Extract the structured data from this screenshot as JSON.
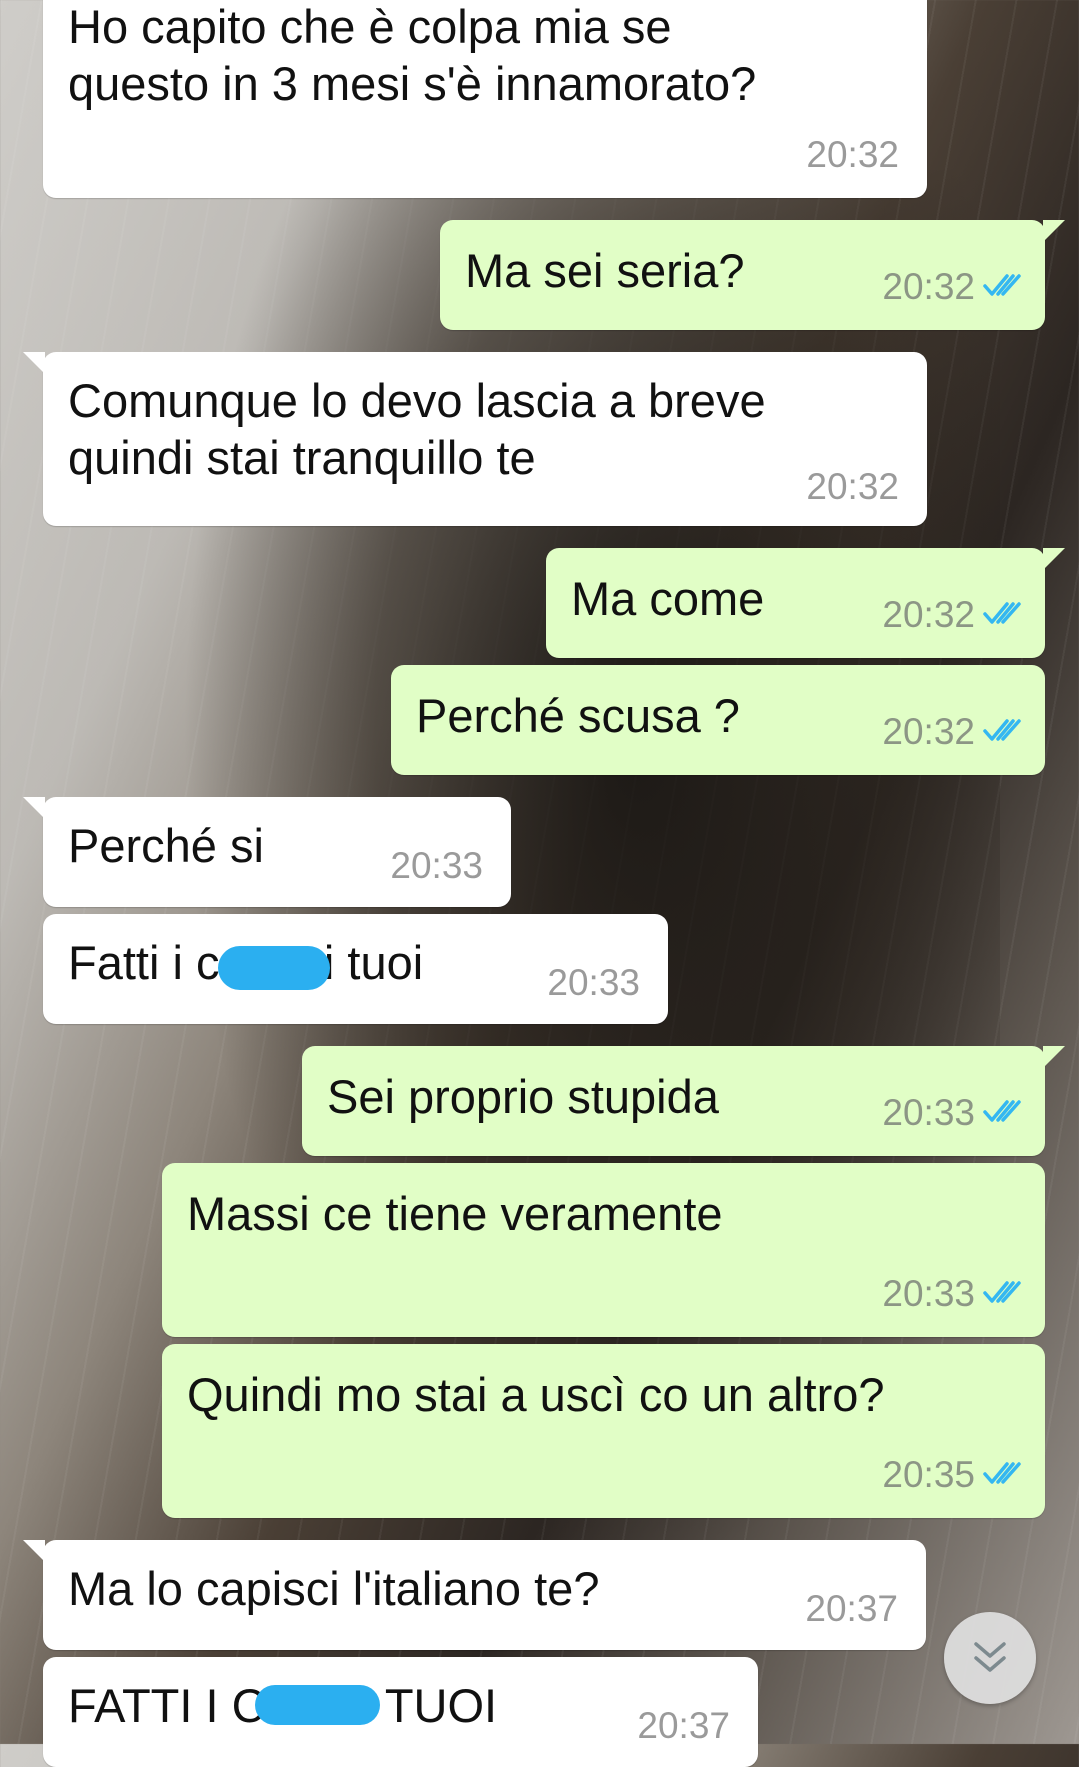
{
  "messages": [
    {
      "id": "m1",
      "dir": "in",
      "text": "Ho capito che è colpa mia se\nquesto in 3 mesi s'è innamorato?",
      "time": "20:32"
    },
    {
      "id": "m2",
      "dir": "out",
      "text": "Ma sei seria?",
      "time": "20:32",
      "status": "read"
    },
    {
      "id": "m3",
      "dir": "in",
      "text": "Comunque lo devo lascia a breve\nquindi stai tranquillo te",
      "time": "20:32"
    },
    {
      "id": "m4",
      "dir": "out",
      "text": "Ma come",
      "time": "20:32",
      "status": "read"
    },
    {
      "id": "m5",
      "dir": "out",
      "text": "Perché scusa ?",
      "time": "20:32",
      "status": "read"
    },
    {
      "id": "m6",
      "dir": "in",
      "text": "Perché si",
      "time": "20:33"
    },
    {
      "id": "m7",
      "dir": "in",
      "text": "Fatti i c        i tuoi",
      "time": "20:33"
    },
    {
      "id": "m8",
      "dir": "out",
      "text": "Sei proprio stupida",
      "time": "20:33",
      "status": "read"
    },
    {
      "id": "m9",
      "dir": "out",
      "text": "Massi ce tiene veramente",
      "time": "20:33",
      "status": "read"
    },
    {
      "id": "m10",
      "dir": "out",
      "text": "Quindi mo stai a uscì co un altro?",
      "time": "20:35",
      "status": "read"
    },
    {
      "id": "m11",
      "dir": "in",
      "text": "Ma lo capisci l'italiano te?",
      "time": "20:37"
    },
    {
      "id": "m12",
      "dir": "in",
      "text": "FATTI I C     ZI TUOI",
      "time": "20:37"
    }
  ],
  "colors": {
    "incoming_bubble": "#ffffff",
    "outgoing_bubble": "#e1fec6",
    "read_ticks": "#34b7f1",
    "censor_mark": "#2baff0",
    "timestamp": "#9a9a9a"
  },
  "icons": {
    "read_receipt": "double-check-icon",
    "scroll_down": "double-chevron-down-icon"
  }
}
